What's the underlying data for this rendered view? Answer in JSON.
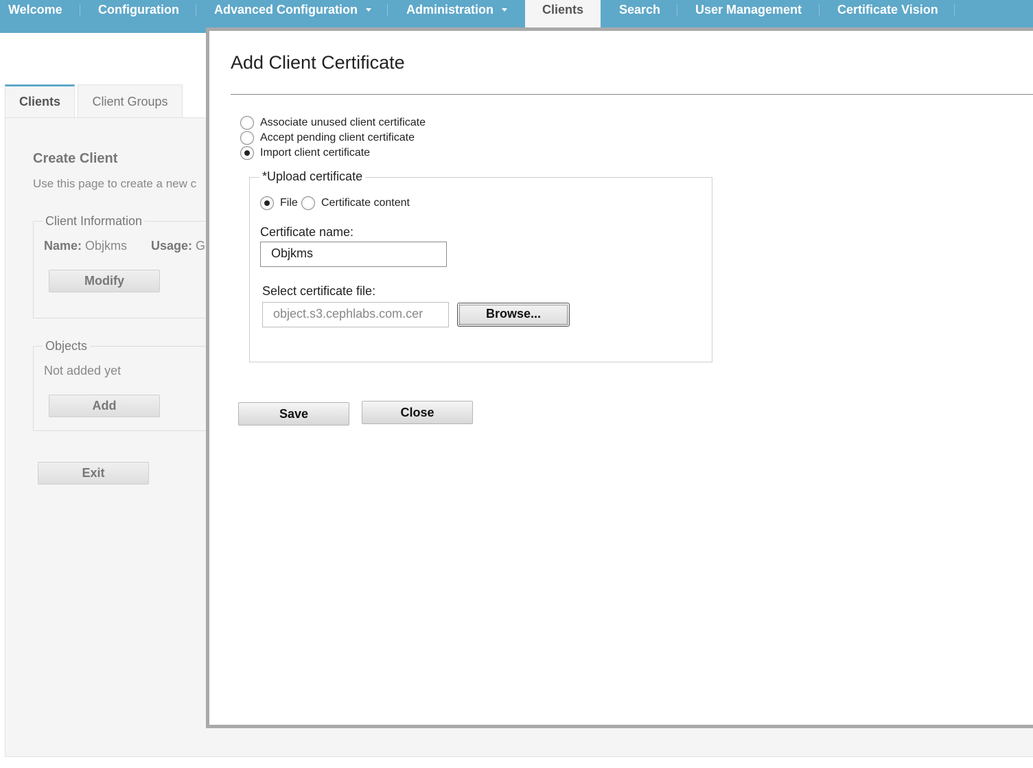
{
  "nav": {
    "items": [
      {
        "label": "Welcome"
      },
      {
        "label": "Configuration"
      },
      {
        "label": "Advanced Configuration"
      },
      {
        "label": "Administration"
      },
      {
        "label": "Clients"
      },
      {
        "label": "Search"
      },
      {
        "label": "User Management"
      },
      {
        "label": "Certificate Vision"
      }
    ],
    "active": "Clients"
  },
  "page": {
    "tabs": [
      {
        "label": "Clients"
      },
      {
        "label": "Client Groups"
      }
    ],
    "title": "Create Client",
    "description": "Use this page to create a new c",
    "client_info": {
      "legend": "Client Information",
      "name_label": "Name:",
      "name_value": "Objkms",
      "usage_label": "Usage:",
      "usage_value": "G",
      "modify_label": "Modify"
    },
    "objects": {
      "legend": "Objects",
      "empty_text": "Not added yet",
      "add_label": "Add"
    },
    "exit_label": "Exit"
  },
  "modal": {
    "title": "Add Client Certificate",
    "options": [
      {
        "label": "Associate unused client certificate",
        "checked": false
      },
      {
        "label": "Accept pending client certificate",
        "checked": false
      },
      {
        "label": "Import client certificate",
        "checked": true
      }
    ],
    "upload": {
      "legend": "*Upload certificate",
      "source_options": [
        {
          "label": "File",
          "checked": true
        },
        {
          "label": "Certificate content",
          "checked": false
        }
      ],
      "cert_name_label": "Certificate name:",
      "cert_name_value": "Objkms",
      "file_label": "Select certificate file:",
      "file_value": "object.s3.cephlabs.com.cer",
      "browse_label": "Browse..."
    },
    "save_label": "Save",
    "close_label": "Close"
  }
}
